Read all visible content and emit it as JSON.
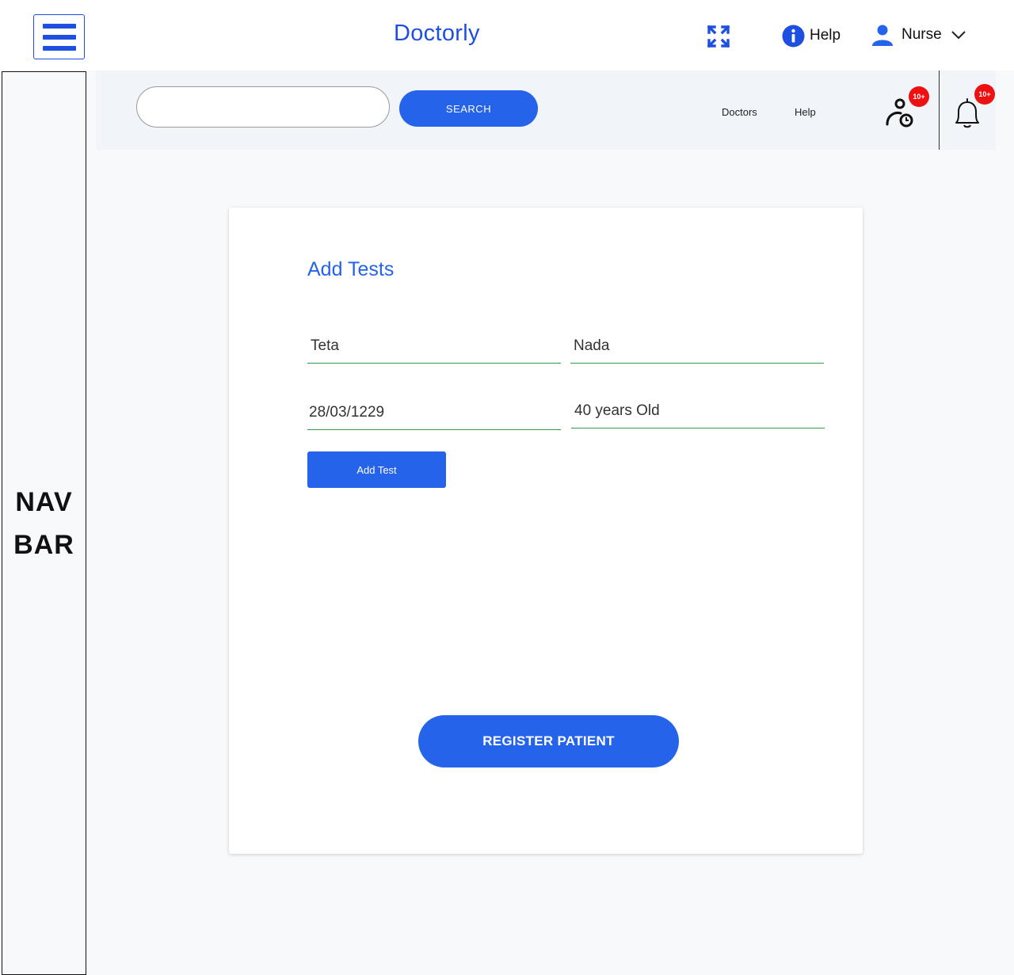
{
  "header": {
    "brand": "Doctorly",
    "help_label": "Help",
    "user_role": "Nurse"
  },
  "navbar": {
    "label": "NAV\nBAR"
  },
  "subbar": {
    "search_value": "",
    "search_button": "SEARCH",
    "links": [
      "Doctors",
      "Help"
    ],
    "patients_badge": "10+",
    "notifications_badge": "10+"
  },
  "form": {
    "title": "Add Tests",
    "first_name": "Teta",
    "last_name": "Nada",
    "birth_date": "28/03/1229",
    "age": "40 years Old",
    "add_test_button": "Add Test",
    "register_button": "REGISTER PATIENT"
  },
  "colors": {
    "brand": "#1f4fe0",
    "primary_button": "#2563eb",
    "field_underline": "#2e9e4e",
    "badge": "#ee1111"
  },
  "icons": [
    "hamburger-icon",
    "expand-icon",
    "info-icon",
    "user-icon",
    "chevron-down-icon",
    "patient-queue-icon",
    "bell-icon"
  ]
}
